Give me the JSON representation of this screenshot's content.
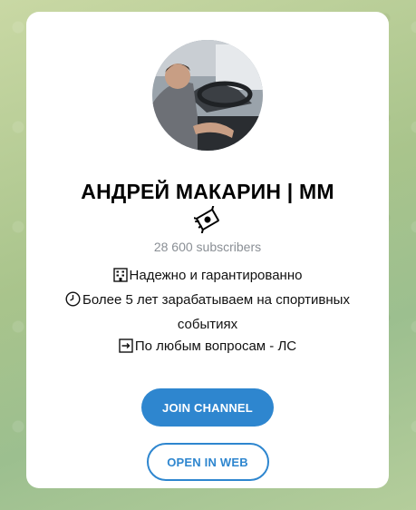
{
  "channel": {
    "title": "АНДРЕЙ МАКАРИН | ММ",
    "subscribers": "28 600 subscribers",
    "avatar_alt": "photo of man driving a car",
    "title_emoji_icon": "money-with-wings-icon"
  },
  "description": {
    "line1": "Надежно и гарантированно",
    "line1_icon": "office-building-icon",
    "line2": "Более 5 лет зарабатываем на спортивных событиях",
    "line2_icon": "clock-icon",
    "line3": "По любым вопросам - ЛС",
    "line3_icon": "arrow-right-box-icon"
  },
  "buttons": {
    "join": "JOIN CHANNEL",
    "open_web": "OPEN IN WEB"
  },
  "colors": {
    "accent": "#2e86cf",
    "background": "#a9c48c",
    "subtitle": "#8a8f95"
  }
}
